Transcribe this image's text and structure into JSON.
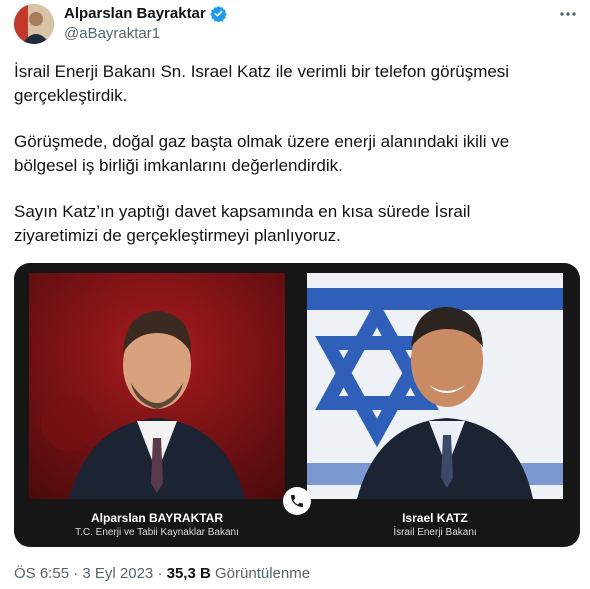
{
  "author": {
    "name": "Alparslan Bayraktar",
    "handle": "@aBayraktar1",
    "verified_color": "#1d9bf0"
  },
  "more_icon": "ellipsis-icon",
  "tweet": {
    "paragraphs": [
      "İsrail Enerji Bakanı Sn. Israel Katz ile verimli bir telefon görüşmesi gerçekleştirdik.",
      "Görüşmede, doğal gaz başta olmak üzere enerji alanındaki ikili ve bölgesel iş birliği imkanlarını değerlendirdik.",
      "Sayın Katz’ın yaptığı davet kapsamında en kısa sürede İsrail ziyaretimizi de gerçekleştirmeyi planlıyoruz."
    ]
  },
  "media": {
    "left": {
      "name": "Alparslan BAYRAKTAR",
      "title": "T.C. Enerji ve Tabii Kaynaklar Bakanı"
    },
    "right": {
      "name": "Israel KATZ",
      "title": "İsrail Enerji Bakanı"
    },
    "center_icon": "phone-icon"
  },
  "meta": {
    "time": "ÖS 6:55",
    "date": "3 Eyl 2023",
    "views": "35,3 B",
    "views_label": "Görüntülenme"
  }
}
